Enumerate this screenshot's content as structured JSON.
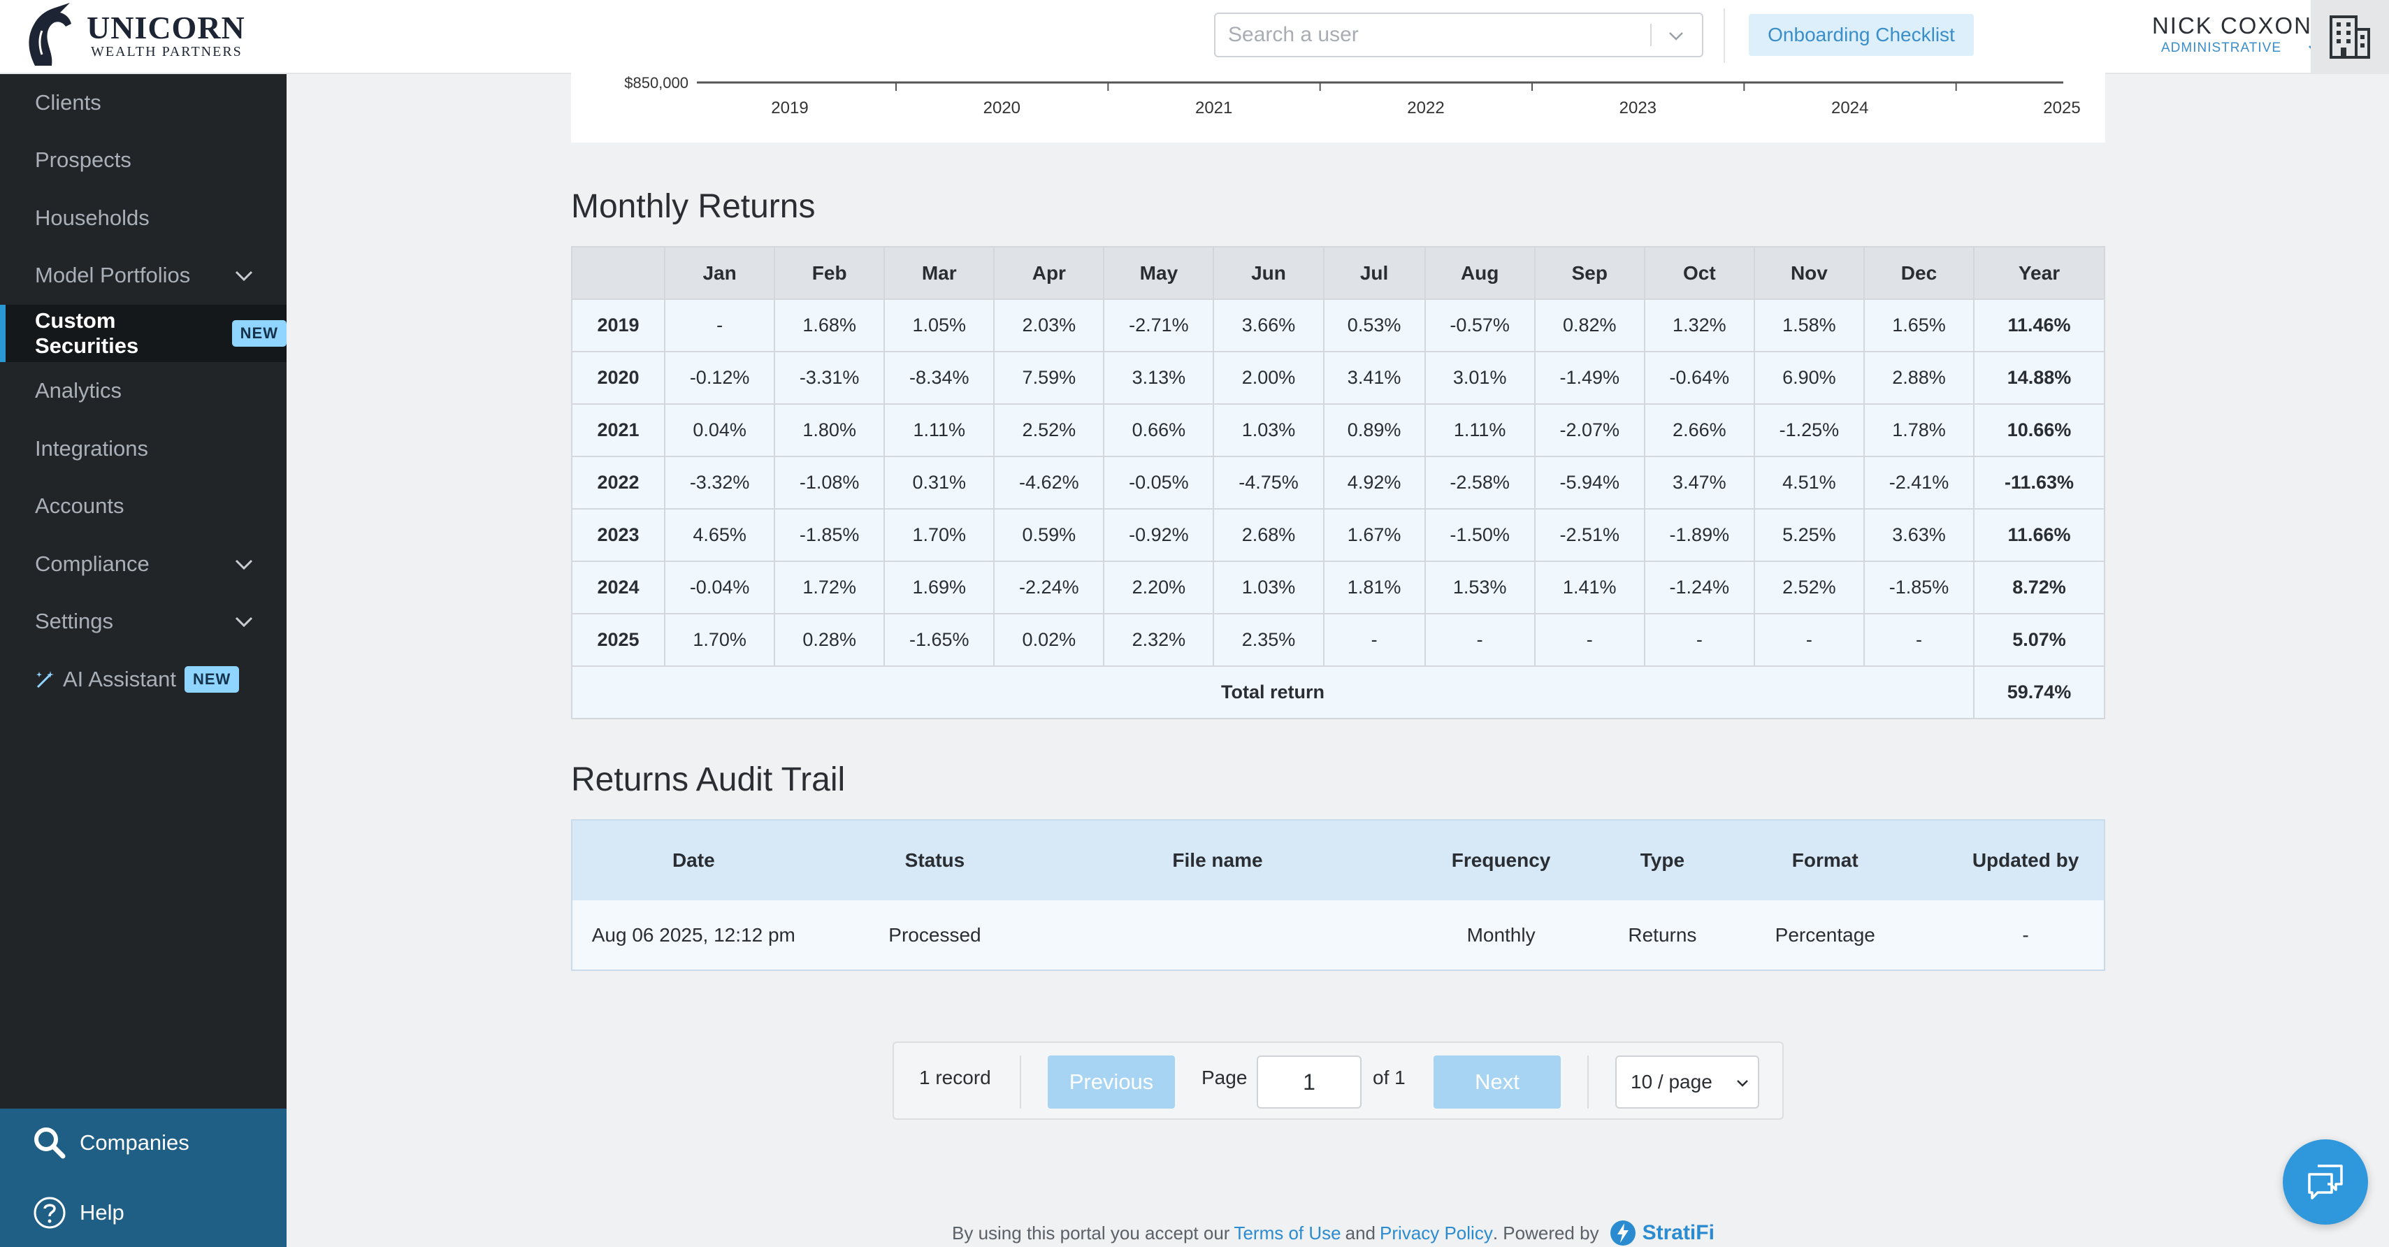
{
  "header": {
    "logo_name": "UNICORN",
    "logo_sub": "WEALTH PARTNERS",
    "search_placeholder": "Search a user",
    "onboarding_label": "Onboarding Checklist",
    "user_name": "NICK COXON",
    "user_role": "ADMINISTRATIVE"
  },
  "sidebar": {
    "items": [
      {
        "label": "Clients"
      },
      {
        "label": "Prospects"
      },
      {
        "label": "Households"
      },
      {
        "label": "Model Portfolios"
      },
      {
        "label": "Custom Securities",
        "badge": "NEW"
      },
      {
        "label": "Analytics"
      },
      {
        "label": "Integrations"
      },
      {
        "label": "Accounts"
      },
      {
        "label": "Compliance"
      },
      {
        "label": "Settings"
      },
      {
        "label": "AI Assistant",
        "badge": "NEW"
      }
    ],
    "bottom": {
      "companies": "Companies",
      "help": "Help"
    }
  },
  "chart_data": {
    "type": "line",
    "ytick_visible": "$850,000",
    "x_ticks": [
      "2019",
      "2020",
      "2021",
      "2022",
      "2023",
      "2024",
      "2025"
    ]
  },
  "monthly_returns": {
    "title": "Monthly Returns",
    "columns": [
      "",
      "Jan",
      "Feb",
      "Mar",
      "Apr",
      "May",
      "Jun",
      "Jul",
      "Aug",
      "Sep",
      "Oct",
      "Nov",
      "Dec",
      "Year"
    ],
    "rows": [
      [
        "2019",
        "-",
        "1.68%",
        "1.05%",
        "2.03%",
        "-2.71%",
        "3.66%",
        "0.53%",
        "-0.57%",
        "0.82%",
        "1.32%",
        "1.58%",
        "1.65%",
        "11.46%"
      ],
      [
        "2020",
        "-0.12%",
        "-3.31%",
        "-8.34%",
        "7.59%",
        "3.13%",
        "2.00%",
        "3.41%",
        "3.01%",
        "-1.49%",
        "-0.64%",
        "6.90%",
        "2.88%",
        "14.88%"
      ],
      [
        "2021",
        "0.04%",
        "1.80%",
        "1.11%",
        "2.52%",
        "0.66%",
        "1.03%",
        "0.89%",
        "1.11%",
        "-2.07%",
        "2.66%",
        "-1.25%",
        "1.78%",
        "10.66%"
      ],
      [
        "2022",
        "-3.32%",
        "-1.08%",
        "0.31%",
        "-4.62%",
        "-0.05%",
        "-4.75%",
        "4.92%",
        "-2.58%",
        "-5.94%",
        "3.47%",
        "4.51%",
        "-2.41%",
        "-11.63%"
      ],
      [
        "2023",
        "4.65%",
        "-1.85%",
        "1.70%",
        "0.59%",
        "-0.92%",
        "2.68%",
        "1.67%",
        "-1.50%",
        "-2.51%",
        "-1.89%",
        "5.25%",
        "3.63%",
        "11.66%"
      ],
      [
        "2024",
        "-0.04%",
        "1.72%",
        "1.69%",
        "-2.24%",
        "2.20%",
        "1.03%",
        "1.81%",
        "1.53%",
        "1.41%",
        "-1.24%",
        "2.52%",
        "-1.85%",
        "8.72%"
      ],
      [
        "2025",
        "1.70%",
        "0.28%",
        "-1.65%",
        "0.02%",
        "2.32%",
        "2.35%",
        "-",
        "-",
        "-",
        "-",
        "-",
        "-",
        "5.07%"
      ]
    ],
    "total_label": "Total return",
    "total_value": "59.74%"
  },
  "audit": {
    "title": "Returns Audit Trail",
    "columns": [
      "Date",
      "Status",
      "File name",
      "Frequency",
      "Type",
      "Format",
      "Updated by"
    ],
    "rows": [
      [
        "Aug 06 2025, 12:12 pm",
        "Processed",
        "",
        "Monthly",
        "Returns",
        "Percentage",
        "-"
      ]
    ]
  },
  "pagination": {
    "records": "1 record",
    "previous": "Previous",
    "page_label": "Page",
    "page_value": "1",
    "of_label": "of 1",
    "next": "Next",
    "per_page": "10 / page"
  },
  "footer": {
    "prefix": "By using this portal you accept our",
    "terms": "Terms of Use",
    "and": "and",
    "privacy": "Privacy Policy",
    "powered": ". Powered by",
    "brand": "StratiFi"
  },
  "colors": {
    "accent": "#2b98d6",
    "sidebar_bg": "#212528",
    "sidebar_bottom_bg": "#1f5f85",
    "badge_bg": "#8fd5ff"
  }
}
